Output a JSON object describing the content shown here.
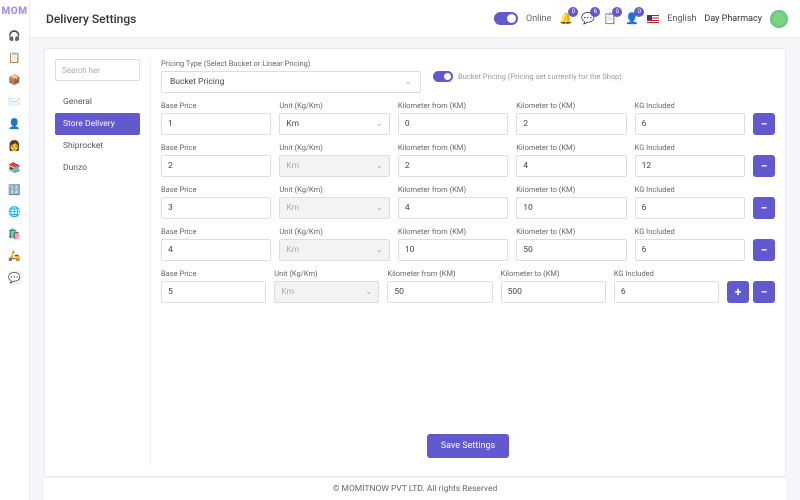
{
  "brand": "MOM",
  "header": {
    "title": "Delivery Settings",
    "online_label": "Online",
    "language": "English",
    "user_name": "Day Pharmacy",
    "badges": {
      "bell": "0",
      "chat": "6",
      "todo": "0",
      "user": "0"
    }
  },
  "sidebar_tabs": {
    "search_placeholder": "Search her",
    "items": [
      {
        "label": "General",
        "active": false
      },
      {
        "label": "Store Delivery",
        "active": true
      },
      {
        "label": "Shiprocket",
        "active": false
      },
      {
        "label": "Dunzo",
        "active": false
      }
    ]
  },
  "pricing": {
    "type_label": "Pricing Type (Select Bucket or Linear Pricing)",
    "type_value": "Bucket Pricing",
    "shop_toggle_label": "Bucket Pricing (Pricing set currently for the Shop)"
  },
  "column_labels": {
    "base": "Base Price",
    "unit": "Unit (Kg/Km)",
    "kmfrom": "Kilometer from (KM)",
    "kmto": "Kilometer to (KM)",
    "kg": "KG Included"
  },
  "rows": [
    {
      "base": "1",
      "unit": "Km",
      "unit_disabled": false,
      "kmfrom": "0",
      "kmto": "2",
      "kg": "6",
      "buttons": [
        "-"
      ]
    },
    {
      "base": "2",
      "unit": "Km",
      "unit_disabled": true,
      "kmfrom": "2",
      "kmto": "4",
      "kg": "12",
      "buttons": [
        "-"
      ]
    },
    {
      "base": "3",
      "unit": "Km",
      "unit_disabled": true,
      "kmfrom": "4",
      "kmto": "10",
      "kg": "6",
      "buttons": [
        "-"
      ]
    },
    {
      "base": "4",
      "unit": "Km",
      "unit_disabled": true,
      "kmfrom": "10",
      "kmto": "50",
      "kg": "6",
      "buttons": [
        "-"
      ]
    },
    {
      "base": "5",
      "unit": "Km",
      "unit_disabled": true,
      "kmfrom": "50",
      "kmto": "500",
      "kg": "6",
      "buttons": [
        "+",
        "-"
      ]
    }
  ],
  "buttons": {
    "save": "Save Settings",
    "add": "+",
    "remove": "−"
  },
  "footer": "© MOMITNOW PVT LTD. All rights Reserved"
}
